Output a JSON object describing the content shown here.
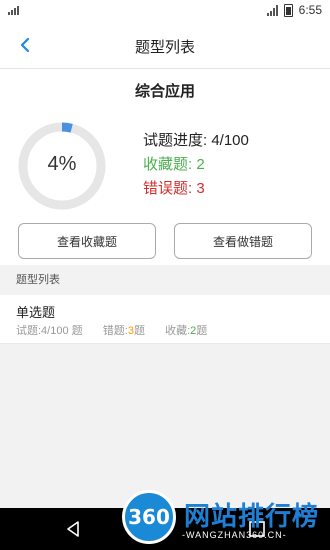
{
  "status_bar": {
    "time": "6:55"
  },
  "header": {
    "title": "题型列表"
  },
  "summary": {
    "heading": "综合应用",
    "progress_percent_label": "4%",
    "progress_fraction": 0.04,
    "progress_text": "试题进度: 4/100",
    "favorites_text": "收藏题: 2",
    "errors_text": "错误题: 3"
  },
  "buttons": {
    "view_favorites": "查看收藏题",
    "view_wrong": "查看做错题"
  },
  "section": {
    "label": "题型列表"
  },
  "types": [
    {
      "name": "单选题",
      "progress_label": "试题:4/100 题",
      "wrong_prefix": "错题:",
      "wrong_count": "3",
      "wrong_suffix": "题",
      "fav_prefix": "收藏:",
      "fav_count": "2",
      "fav_suffix": "题"
    }
  ],
  "watermark": {
    "badge": "360",
    "text": "网站排行榜",
    "sub": "-WANGZHAN360.CN-"
  },
  "colors": {
    "accent": "#1e88e5",
    "ring_track": "#e6e6e6",
    "ring_fill": "#4a90e2",
    "favorites": "#4caf50",
    "errors": "#d32f2f",
    "wrong_count": "#ff9800",
    "fav_count": "#4caf50"
  }
}
